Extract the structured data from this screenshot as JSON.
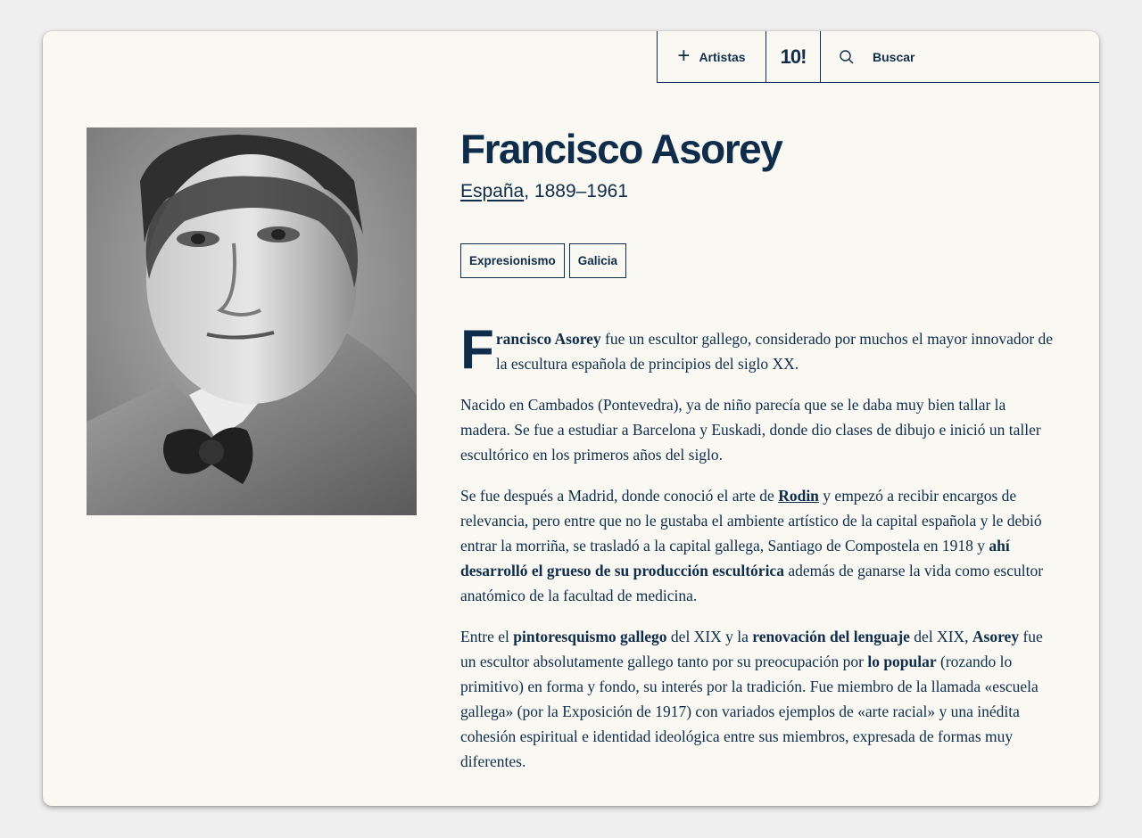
{
  "nav": {
    "artists_label": "Artistas",
    "logo": "10!",
    "search_label": "Buscar"
  },
  "artist": {
    "name": "Francisco Asorey",
    "country": "España",
    "years": ", 1889–1961",
    "tags": [
      "Expresionismo",
      "Galicia"
    ]
  },
  "bio": {
    "p1": {
      "dropcap": "F",
      "bold": "rancisco Asorey",
      "text": " fue un escultor gallego, considerado por muchos el mayor innovador de la escultura española de principios del siglo XX."
    },
    "p2": "Nacido en Cambados (Pontevedra), ya de niño parecía que se le daba muy bien tallar la madera. Se fue a estudiar a Barcelona y Euskadi, donde dio clases de dibujo e inició un taller escultórico en los primeros años del siglo.",
    "p3": {
      "a": "Se fue después a Madrid, donde conoció el arte de ",
      "link": "Rodin",
      "b": " y empezó a recibir encargos de relevancia, pero entre que no le gustaba el ambiente artístico de la capital española y le debió entrar la morriña, se trasladó a la capital gallega, Santiago de Compostela en 1918 y ",
      "bold": "ahí desarrolló el grueso de su producción escultórica",
      "c": " además de ganarse la vida como escultor anatómico de la facultad de medicina."
    },
    "p4": {
      "a": "Entre el ",
      "b1": "pintoresquismo gallego",
      "b": " del XIX y la ",
      "b2": "renovación del lenguaje",
      "c": " del XIX, ",
      "b3": "Asorey",
      "d": " fue un escultor absolutamente gallego tanto por su preocupación por ",
      "b4": "lo popular",
      "e": " (rozando lo primitivo) en forma y fondo, su interés por la tradición. Fue miembro de la llamada «escuela gallega» (por la Exposición de 1917) con variados ejemplos de «arte racial» y una inédita cohesión espiritual e identidad ideológica entre sus miembros, expresada de formas muy diferentes."
    }
  },
  "colors": {
    "navy": "#0f2d4a",
    "page_bg": "#faf8f2"
  },
  "icons": [
    "plus-icon",
    "search-icon"
  ]
}
